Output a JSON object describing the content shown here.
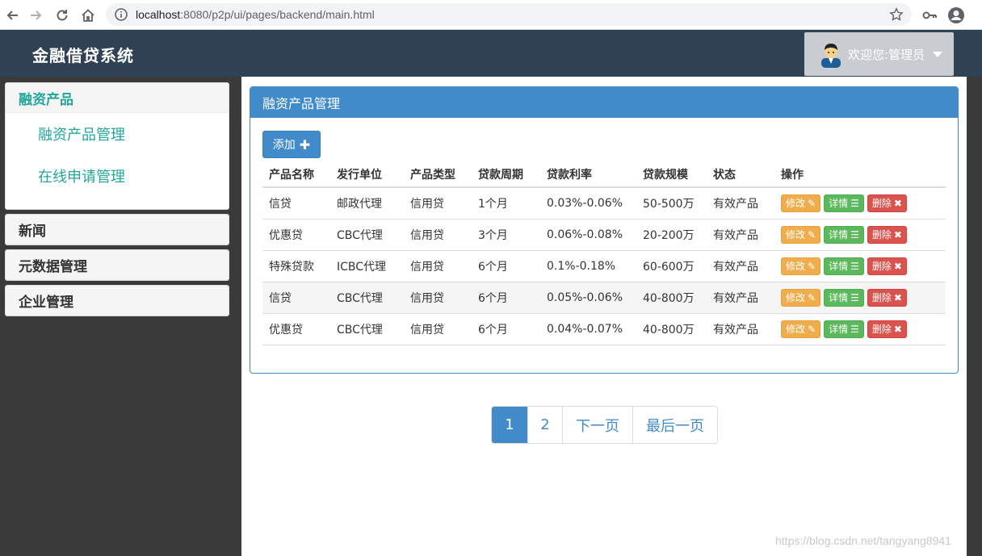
{
  "browser": {
    "url_host": "localhost",
    "url_path": ":8080/p2p/ui/pages/backend/main.html"
  },
  "header": {
    "brand": "金融借贷系统",
    "welcome": "欢迎您:管理员"
  },
  "sidebar": {
    "groups": [
      {
        "label": "融资产品",
        "items": [
          "融资产品管理",
          "在线申请管理"
        ]
      },
      {
        "label": "新闻"
      },
      {
        "label": "元数据管理"
      },
      {
        "label": "企业管理"
      }
    ]
  },
  "main": {
    "panel_title": "融资产品管理",
    "add_label": "添加",
    "columns": [
      "产品名称",
      "发行单位",
      "产品类型",
      "贷款周期",
      "贷款利率",
      "贷款规模",
      "状态",
      "操作"
    ],
    "rows": [
      [
        "信贷",
        "邮政代理",
        "信用贷",
        "1个月",
        "0.03%-0.06%",
        "50-500万",
        "有效产品"
      ],
      [
        "优惠贷",
        "CBC代理",
        "信用贷",
        "3个月",
        "0.06%-0.08%",
        "20-200万",
        "有效产品"
      ],
      [
        "特殊贷款",
        "ICBC代理",
        "信用贷",
        "6个月",
        "0.1%-0.18%",
        "60-600万",
        "有效产品"
      ],
      [
        "信贷",
        "CBC代理",
        "信用贷",
        "6个月",
        "0.05%-0.06%",
        "40-800万",
        "有效产品"
      ],
      [
        "优惠贷",
        "CBC代理",
        "信用贷",
        "6个月",
        "0.04%-0.07%",
        "40-800万",
        "有效产品"
      ]
    ],
    "actions": {
      "edit": "修改",
      "detail": "详情",
      "delete": "删除"
    }
  },
  "pagination": {
    "pages": [
      "1",
      "2"
    ],
    "next": "下一页",
    "last": "最后一页",
    "current": "1"
  },
  "watermark": "https://blog.csdn.net/tangyang8941",
  "colors": {
    "header_bg": "#2f4152",
    "primary": "#428bca",
    "accent_text": "#22a59b",
    "edit": "#f0ad4e",
    "detail": "#5cb85c",
    "delete": "#d9534f"
  }
}
